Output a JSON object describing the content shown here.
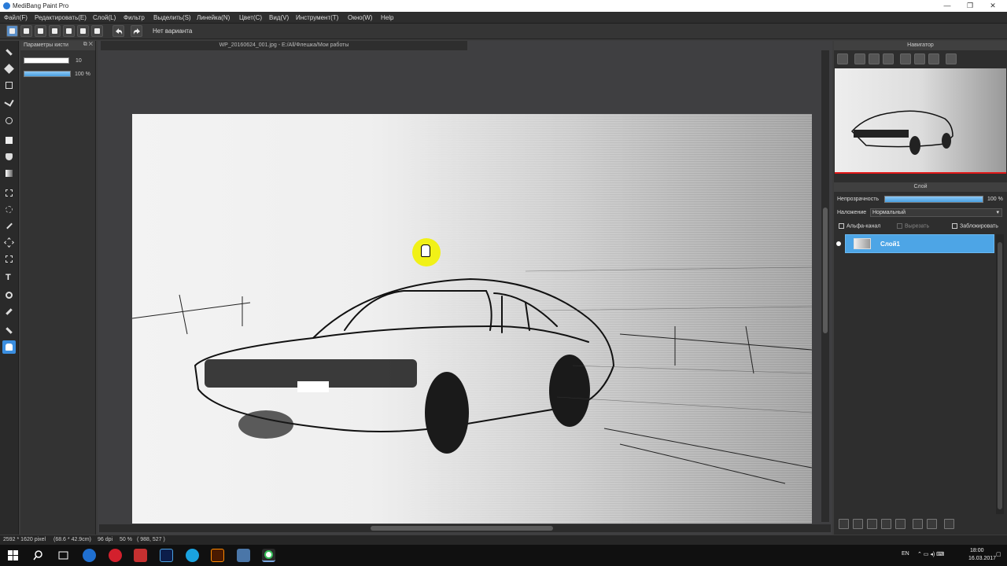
{
  "window": {
    "title": "MediBang Paint Pro"
  },
  "menu": [
    "Файл(F)",
    "Редактировать(E)",
    "Слой(L)",
    "Фильтр",
    "Выделить(S)",
    "Линейка(N)",
    "Цвет(C)",
    "Вид(V)",
    "Инструмент(T)",
    "Окно(W)",
    "Help"
  ],
  "toolbar": {
    "variant_text": "Нет варианта"
  },
  "brush_panel": {
    "title": "Параметры кисти",
    "size_value": "10",
    "opacity_value": "100 %"
  },
  "document": {
    "tab_title": "WP_20160624_001.jpg - E:/All/Флешка/Мои работы"
  },
  "navigator": {
    "title": "Навигатор"
  },
  "layer_panel": {
    "title": "Слой",
    "opacity_label": "Непрозрачность",
    "opacity_value": "100 %",
    "opacity_fraction": 1.0,
    "blend_label": "Наложение",
    "blend_value": "Нормальный",
    "alpha_label": "Альфа-канал",
    "clip_label": "Вырезать",
    "lock_label": "Заблокировать",
    "layers": [
      {
        "name": "Слой1",
        "selected": true
      }
    ]
  },
  "status": {
    "size": "2592 * 1620 pixel",
    "cm": "(68.6 * 42.9cm)",
    "dpi": "96 dpi",
    "zoom": "50 %",
    "coords": "( 988, 527 )"
  },
  "tray": {
    "lang": "EN",
    "time": "18:00",
    "date": "16.03.2017"
  },
  "colors": {
    "accent": "#4da5e6",
    "canvas_bg": "#3f3f41",
    "panel_bg": "#2e2e2e"
  }
}
